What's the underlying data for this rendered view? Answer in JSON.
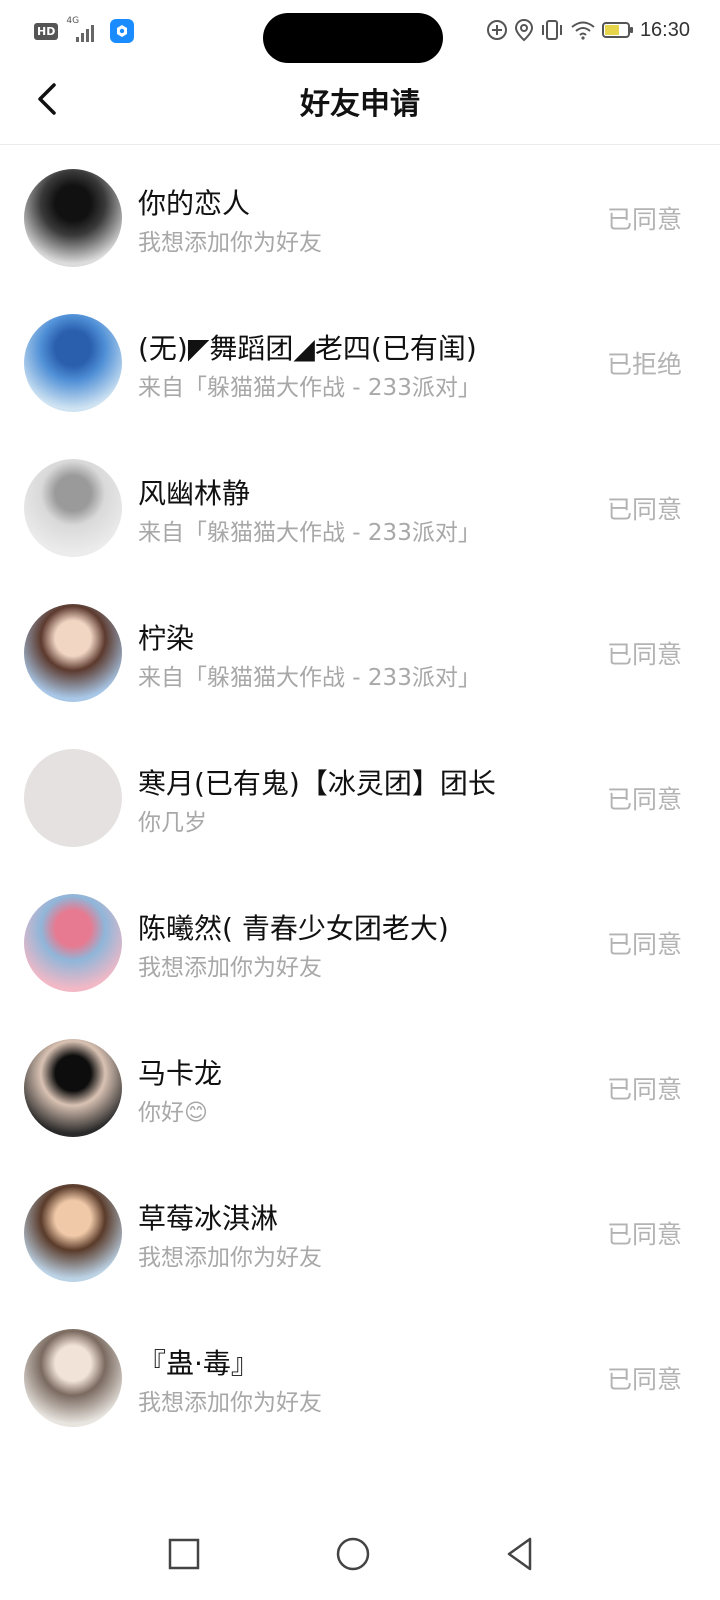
{
  "status_bar": {
    "hd_label": "HD",
    "network_label": "4G",
    "time": "16:30",
    "icons": [
      "hd-icon",
      "signal-icon",
      "app-notification-icon",
      "add-circle-icon",
      "location-icon",
      "vibrate-icon",
      "wifi-icon",
      "battery-icon"
    ]
  },
  "header": {
    "title": "好友申请",
    "back_icon": "chevron-left-icon"
  },
  "requests": [
    {
      "name": "你的恋人",
      "message": "我想添加你为好友",
      "status": "已同意",
      "avatar_colors": [
        "#dcdcdc",
        "#3a3a3a",
        "#111111"
      ]
    },
    {
      "name": "(无)◤舞蹈团◢老四(已有闺)",
      "message": "来自「躲猫猫大作战 - 233派对」",
      "status": "已拒绝",
      "avatar_colors": [
        "#cfe3f2",
        "#4f8fd6",
        "#2a5fae"
      ]
    },
    {
      "name": "风幽林静",
      "message": "来自「躲猫猫大作战 - 233派对」",
      "status": "已同意",
      "avatar_colors": [
        "#ececec",
        "#d9d9d9",
        "#9a9a9a"
      ]
    },
    {
      "name": "柠染",
      "message": "来自「躲猫猫大作战 - 233派对」",
      "status": "已同意",
      "avatar_colors": [
        "#a9c8e8",
        "#5c3a2e",
        "#f2d6c4"
      ]
    },
    {
      "name": "寒月(已有鬼)【冰灵团】团长",
      "message": "你几岁",
      "status": "已同意",
      "avatar_colors": [
        "#e6e1e1",
        "#e6e1e1",
        "#e6e1e1"
      ]
    },
    {
      "name": "陈曦然(  青春少女团老大)",
      "message": "我想添加你为好友",
      "status": "已同意",
      "avatar_colors": [
        "#f2b8c6",
        "#8fb6d9",
        "#e77a90"
      ]
    },
    {
      "name": "马卡龙",
      "message": "你好😊",
      "status": "已同意",
      "avatar_colors": [
        "#2a2a2a",
        "#d9c2b3",
        "#0d0d0d"
      ]
    },
    {
      "name": "草莓冰淇淋",
      "message": "我想添加你为好友",
      "status": "已同意",
      "avatar_colors": [
        "#bcd3e6",
        "#5a3b2a",
        "#f0c9a8"
      ]
    },
    {
      "name": "『蛊·毒』",
      "message": "我想添加你为好友",
      "status": "已同意",
      "avatar_colors": [
        "#e8e4df",
        "#7a6a60",
        "#f2e3d8"
      ]
    }
  ],
  "nav_bar": {
    "icons": [
      "square-recents-icon",
      "circle-home-icon",
      "triangle-back-icon"
    ]
  },
  "colors": {
    "muted_text": "#a8a8a8",
    "status_text": "#b3b3b3",
    "title_text": "#111111",
    "divider": "#ececec"
  }
}
